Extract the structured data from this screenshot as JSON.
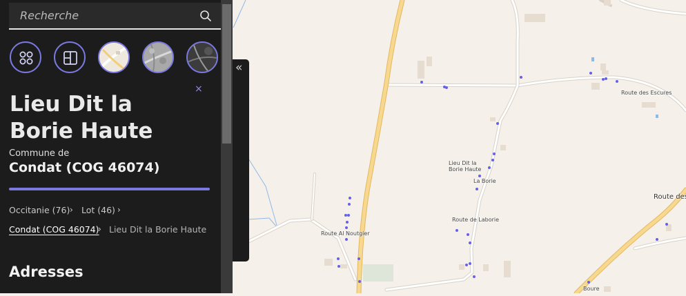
{
  "search": {
    "placeholder": "Recherche"
  },
  "layers": [
    {
      "name": "layers-menu-icon"
    },
    {
      "name": "plan-icon"
    },
    {
      "name": "plan-ign-thumbnail"
    },
    {
      "name": "photo-gray-thumbnail"
    },
    {
      "name": "photo-dark-thumbnail"
    }
  ],
  "place": {
    "title": "Lieu Dit la Borie Haute",
    "commune_prefix": "Commune de",
    "commune_name": "Condat (COG 46074)",
    "close": "×"
  },
  "breadcrumb": {
    "region": "Occitanie (76)",
    "department": "Lot (46)",
    "commune": "Condat (COG 46074)",
    "current": "Lieu Dit la Borie Haute",
    "separator": "›"
  },
  "section": {
    "addresses": "Adresses"
  },
  "collapse": {
    "symbol": "«"
  },
  "map": {
    "labels": {
      "route_escures": "Route des Escures",
      "lieu_dit_1": "Lieu Dit la",
      "lieu_dit_2": "Borie Haute",
      "la_borie": "La Borie",
      "route_laborie": "Route de Laborie",
      "route_al_noutgier": "Route Al Noutgier",
      "route_des_right": "Route des",
      "boure": "Boure"
    },
    "colors": {
      "accent": "#7b78e0",
      "road_main": "#f2cd7b",
      "road_minor": "#ffffff",
      "point": "#6660e8",
      "water": "#8fb8e6",
      "building": "#e6dcd0",
      "background": "#f5f1ea"
    }
  }
}
